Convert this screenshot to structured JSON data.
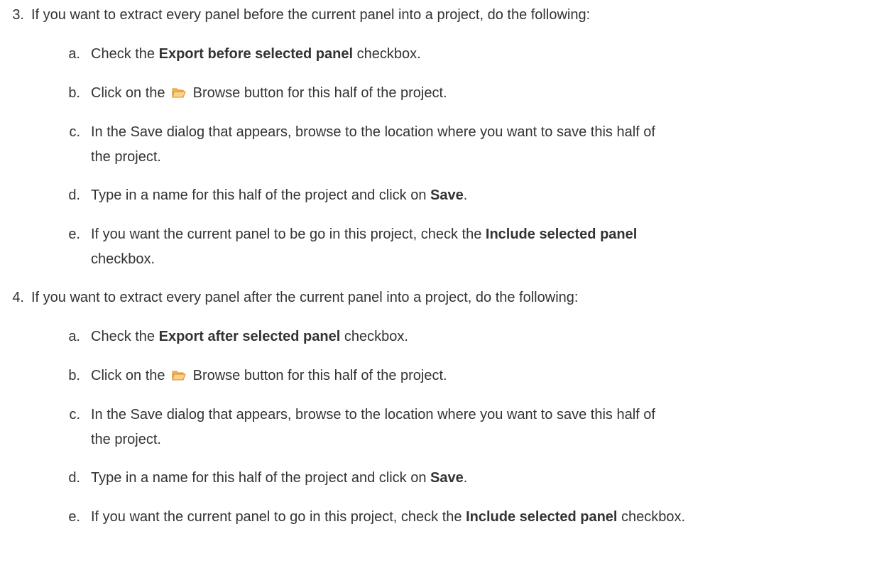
{
  "steps": [
    {
      "number": "3.",
      "text": "If you want to extract every panel before the current panel into a project, do the following:",
      "substeps": {
        "a": {
          "letter": "a.",
          "pre": "Check the ",
          "bold": "Export before selected panel",
          "post": " checkbox."
        },
        "b": {
          "letter": "b.",
          "pre": "Click on the ",
          "icon": "folder-icon",
          "post": " Browse button for this half of the project."
        },
        "c": {
          "letter": "c.",
          "line1": "In the Save dialog that appears, browse to the location where you want to save this half of",
          "line2": "the project."
        },
        "d": {
          "letter": "d.",
          "pre": "Type in a name for this half of the project and click on ",
          "bold": "Save",
          "post": "."
        },
        "e": {
          "letter": "e.",
          "pre": "If you want the current panel to be go in this project, check the ",
          "bold": "Include selected panel",
          "post": "checkbox."
        }
      }
    },
    {
      "number": "4.",
      "text": "If you want to extract every panel after the current panel into a project, do the following:",
      "substeps": {
        "a": {
          "letter": "a.",
          "pre": "Check the ",
          "bold": "Export after selected panel",
          "post": " checkbox."
        },
        "b": {
          "letter": "b.",
          "pre": "Click on the ",
          "icon": "folder-icon",
          "post": " Browse button for this half of the project."
        },
        "c": {
          "letter": "c.",
          "line1": "In the Save dialog that appears, browse to the location where you want to save this half of",
          "line2": "the project."
        },
        "d": {
          "letter": "d.",
          "pre": "Type in a name for this half of the project and click on ",
          "bold": "Save",
          "post": "."
        },
        "e": {
          "letter": "e.",
          "pre": "If you want the current panel to go in this project, check the ",
          "bold": "Include selected panel",
          "post": " checkbox."
        }
      }
    }
  ],
  "colors": {
    "text": "#333333",
    "folder_fill": "#f6b655",
    "folder_front": "#fcd08a",
    "folder_edge": "#d98a1c"
  }
}
